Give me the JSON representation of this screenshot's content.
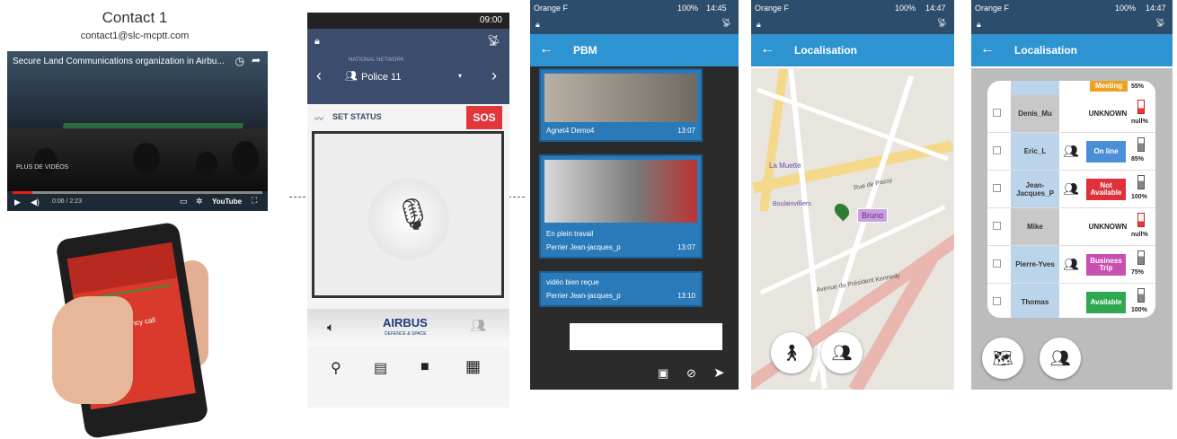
{
  "panel1": {
    "title": "Contact 1",
    "email": "contact1@slc-mcptt.com",
    "video_title": "Secure Land Communications organization in Airbu...",
    "more_videos": "PLUS DE VIDÉOS",
    "time": "0:06 / 2:23",
    "youtube": "YouTube",
    "emergency_label": "Emergency call"
  },
  "panel2": {
    "status_time": "09:00",
    "network_label": "NATIONAL NETWORK",
    "group": "Police 11",
    "set_status": "SET STATUS",
    "sos": "SOS",
    "brand": "AIRBUS",
    "brand_sub": "DEFENCE & SPACE"
  },
  "panel3": {
    "carrier": "Orange F",
    "battery": "100%",
    "clock": "14:45",
    "title": "PBM",
    "messages": [
      {
        "sender": "Agnet4 Demo4",
        "time": "13:07"
      },
      {
        "text": "En plein travail",
        "sender": "Perrier Jean-jacques_p",
        "time": "13:07"
      },
      {
        "text": "vidéo bien reçue",
        "sender": "Perrier Jean-jacques_p",
        "time": "13:10"
      }
    ]
  },
  "panel4": {
    "carrier": "Orange F",
    "battery": "100%",
    "clock": "14:47",
    "title": "Localisation",
    "marker_label": "Bruno",
    "streets": [
      "La Muette",
      "Rue de Passy",
      "Boulainvilliers",
      "Avenue du Président Kennedy"
    ]
  },
  "panel5": {
    "carrier": "Orange F",
    "battery": "100%",
    "clock": "14:47",
    "title": "Localisation",
    "top_status": "Meeting",
    "top_battery": "55%",
    "rows": [
      {
        "name": "Denis_Mu",
        "status": "UNKNOWN",
        "battery": "null%"
      },
      {
        "name": "Eric_L",
        "status": "On line",
        "battery": "85%"
      },
      {
        "name": "Jean-Jacques_P",
        "status": "Not Available",
        "battery": "100%"
      },
      {
        "name": "Mike",
        "status": "UNKNOWN",
        "battery": "null%"
      },
      {
        "name": "Pierre-Yves",
        "status": "Business Trip",
        "battery": "75%"
      },
      {
        "name": "Thomas",
        "status": "Available",
        "battery": "100%"
      }
    ],
    "colors": {
      "online": "#4a90d9",
      "not_available": "#e0303a",
      "business_trip": "#c94fb0",
      "available": "#2fa84f",
      "meeting": "#f0a020"
    }
  }
}
